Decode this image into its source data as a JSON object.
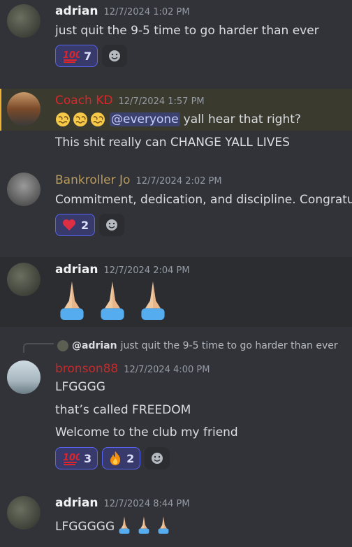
{
  "messages": [
    {
      "user": "adrian",
      "time": "12/7/2024 1:02 PM",
      "lines": [
        "just quit the 9-5 time to go harder than ever"
      ],
      "reactions": [
        {
          "emoji": "hundred-points",
          "count": "7"
        }
      ]
    },
    {
      "user": "Coach KD",
      "time": "12/7/2024 1:57 PM",
      "mention": "@everyone",
      "lines": [
        "yall hear that right?",
        "This shit really can CHANGE YALL LIVES"
      ]
    },
    {
      "user": "Bankroller Jo",
      "time": "12/7/2024 2:02 PM",
      "lines": [
        "Commitment, dedication, and discipline. Congratu"
      ],
      "reactions": [
        {
          "emoji": "heart",
          "count": "2"
        }
      ]
    },
    {
      "user": "adrian",
      "time": "12/7/2024 2:04 PM"
    },
    {
      "reply": {
        "user": "@adrian",
        "text": "just quit the 9-5 time to go harder than ever"
      },
      "user": "bronson88",
      "time": "12/7/2024 4:00 PM",
      "lines": [
        "LFGGGG",
        "that’s called FREEDOM",
        "Welcome to the club my friend"
      ],
      "reactions": [
        {
          "emoji": "hundred-points",
          "count": "3"
        },
        {
          "emoji": "fire",
          "count": "2"
        }
      ]
    },
    {
      "user": "adrian",
      "time": "12/7/2024 8:44 PM",
      "lines": [
        "LFGGGGG"
      ]
    }
  ],
  "colors": {
    "adrian": "#f2f3f5",
    "coach": "#e0242a",
    "bankroller": "#b89b5e",
    "bronson": "#c42b2b",
    "background": "#323339",
    "highlight": "#3b3a2f"
  }
}
